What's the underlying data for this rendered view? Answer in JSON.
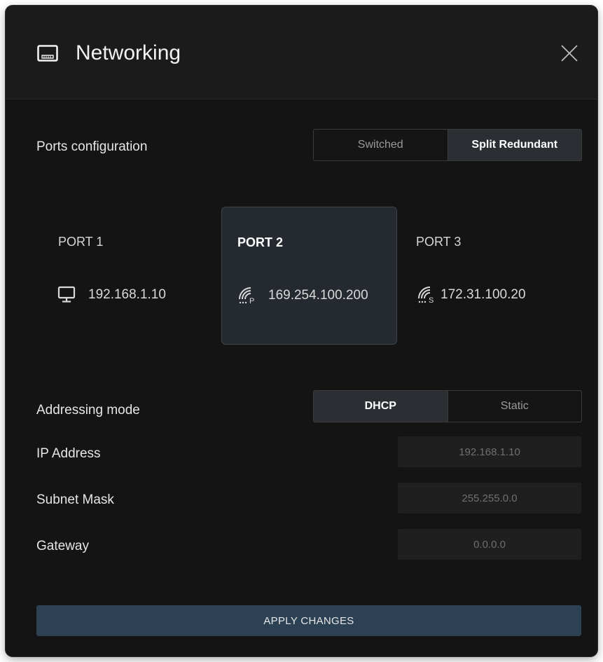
{
  "dialog": {
    "title": "Networking",
    "icon": "ethernet-port-icon",
    "close_icon": "close-icon"
  },
  "ports_configuration": {
    "label": "Ports configuration",
    "options": [
      "Switched",
      "Split Redundant"
    ],
    "selected": "Split Redundant"
  },
  "ports": [
    {
      "name": "PORT 1",
      "ip": "192.168.1.10",
      "icon": "monitor-icon",
      "active": false
    },
    {
      "name": "PORT 2",
      "ip": "169.254.100.200",
      "icon": "primary-signal-icon",
      "icon_badge": "P",
      "active": true
    },
    {
      "name": "PORT 3",
      "ip": "172.31.100.20",
      "icon": "secondary-signal-icon",
      "icon_badge": "S",
      "active": false
    }
  ],
  "addressing_mode": {
    "label": "Addressing mode",
    "options": [
      "DHCP",
      "Static"
    ],
    "selected": "DHCP"
  },
  "fields": {
    "ip_address": {
      "label": "IP Address",
      "value": "192.168.1.10"
    },
    "subnet_mask": {
      "label": "Subnet Mask",
      "value": "255.255.0.0"
    },
    "gateway": {
      "label": "Gateway",
      "value": "0.0.0.0"
    }
  },
  "apply_label": "APPLY CHANGES",
  "colors": {
    "background": "#141414",
    "header": "#1b1b1b",
    "active_segment": "#2b2f34",
    "active_card": "#252a30",
    "apply_button": "#2c4254"
  }
}
